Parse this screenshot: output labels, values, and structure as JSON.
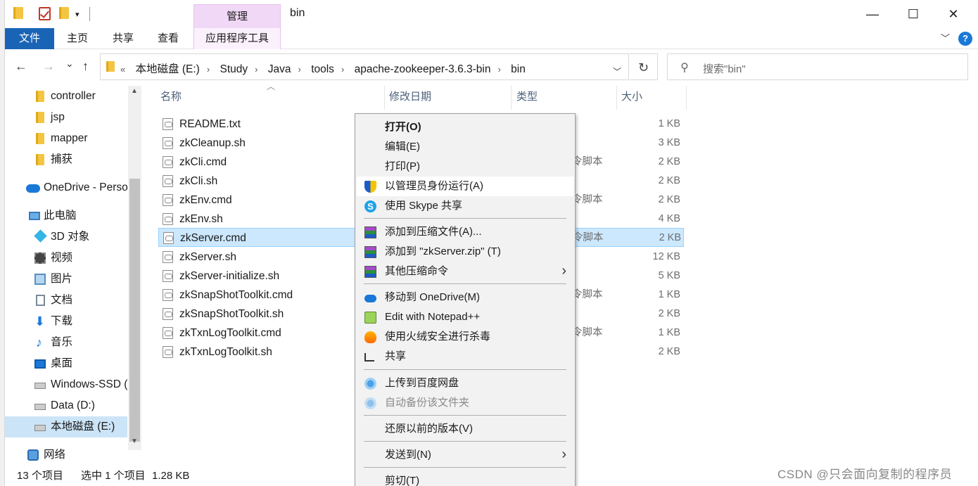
{
  "window": {
    "title": "bin",
    "contextual_group": "管理",
    "min": "—",
    "max": "☐",
    "close": "✕"
  },
  "ribbon": {
    "tabs": [
      "文件",
      "主页",
      "共享",
      "查看",
      "应用程序工具"
    ],
    "expand": "﹀",
    "help": "?"
  },
  "nav": {
    "back": "←",
    "forward": "→",
    "recent": "⌄",
    "up": "↑",
    "refresh": "↻",
    "address_prefix": "«",
    "breadcrumbs": [
      "本地磁盘 (E:)",
      "Study",
      "Java",
      "tools",
      "apache-zookeeper-3.6.3-bin",
      "bin"
    ],
    "search_placeholder": "搜索\"bin\""
  },
  "sidebar": {
    "items": [
      {
        "label": "controller",
        "icon": "folder-icon"
      },
      {
        "label": "jsp",
        "icon": "folder-icon"
      },
      {
        "label": "mapper",
        "icon": "folder-icon"
      },
      {
        "label": "捕获",
        "icon": "folder-icon"
      },
      {
        "label": "OneDrive - Perso",
        "icon": "onedrive-icon"
      },
      {
        "label": "此电脑",
        "icon": "pc-icon"
      },
      {
        "label": "3D 对象",
        "icon": "3d-objects-icon"
      },
      {
        "label": "视频",
        "icon": "video-icon"
      },
      {
        "label": "图片",
        "icon": "pictures-icon"
      },
      {
        "label": "文档",
        "icon": "documents-icon"
      },
      {
        "label": "下载",
        "icon": "downloads-icon"
      },
      {
        "label": "音乐",
        "icon": "music-icon"
      },
      {
        "label": "桌面",
        "icon": "desktop-icon"
      },
      {
        "label": "Windows-SSD (",
        "icon": "drive-icon"
      },
      {
        "label": "Data (D:)",
        "icon": "drive-icon"
      },
      {
        "label": "本地磁盘 (E:)",
        "icon": "drive-icon"
      },
      {
        "label": "网络",
        "icon": "network-icon"
      }
    ]
  },
  "filelist": {
    "columns": [
      "名称",
      "修改日期",
      "类型",
      "大小"
    ],
    "rows": [
      {
        "name": "README.txt",
        "type": "",
        "size": "1 KB"
      },
      {
        "name": "zkCleanup.sh",
        "type": "",
        "size": "3 KB"
      },
      {
        "name": "zkCli.cmd",
        "type": "令脚本",
        "size": "2 KB"
      },
      {
        "name": "zkCli.sh",
        "type": "",
        "size": "2 KB"
      },
      {
        "name": "zkEnv.cmd",
        "type": "令脚本",
        "size": "2 KB"
      },
      {
        "name": "zkEnv.sh",
        "type": "",
        "size": "4 KB"
      },
      {
        "name": "zkServer.cmd",
        "type": "令脚本",
        "size": "2 KB"
      },
      {
        "name": "zkServer.sh",
        "type": "",
        "size": "12 KB"
      },
      {
        "name": "zkServer-initialize.sh",
        "type": "",
        "size": "5 KB"
      },
      {
        "name": "zkSnapShotToolkit.cmd",
        "type": "令脚本",
        "size": "1 KB"
      },
      {
        "name": "zkSnapShotToolkit.sh",
        "type": "",
        "size": "2 KB"
      },
      {
        "name": "zkTxnLogToolkit.cmd",
        "type": "令脚本",
        "size": "1 KB"
      },
      {
        "name": "zkTxnLogToolkit.sh",
        "type": "",
        "size": "2 KB"
      }
    ]
  },
  "context_menu": {
    "items": [
      {
        "label": "打开(O)",
        "icon": ""
      },
      {
        "label": "编辑(E)",
        "icon": ""
      },
      {
        "label": "打印(P)",
        "icon": ""
      },
      {
        "label": "以管理员身份运行(A)",
        "icon": "uac-shield-icon"
      },
      {
        "label": "使用 Skype 共享",
        "icon": "skype-icon"
      },
      {
        "label": "添加到压缩文件(A)...",
        "icon": "winrar-icon"
      },
      {
        "label": "添加到 \"zkServer.zip\" (T)",
        "icon": "winrar-icon"
      },
      {
        "label": "其他压缩命令",
        "icon": "winrar-icon"
      },
      {
        "label": "移动到 OneDrive(M)",
        "icon": "onedrive-icon"
      },
      {
        "label": "Edit with Notepad++",
        "icon": "notepadpp-icon"
      },
      {
        "label": "使用火绒安全进行杀毒",
        "icon": "huorong-icon"
      },
      {
        "label": "共享",
        "icon": "share-icon"
      },
      {
        "label": "上传到百度网盘",
        "icon": "baidu-netdisk-icon"
      },
      {
        "label": "自动备份该文件夹",
        "icon": "baidu-netdisk-icon"
      },
      {
        "label": "还原以前的版本(V)",
        "icon": ""
      },
      {
        "label": "发送到(N)",
        "icon": ""
      },
      {
        "label": "剪切(T)",
        "icon": ""
      }
    ],
    "submenu_arrow": "›"
  },
  "status": {
    "count": "13 个项目",
    "selected": "选中 1 个项目",
    "size": "1.28 KB"
  },
  "watermark": "CSDN @只会面向复制的程序员"
}
